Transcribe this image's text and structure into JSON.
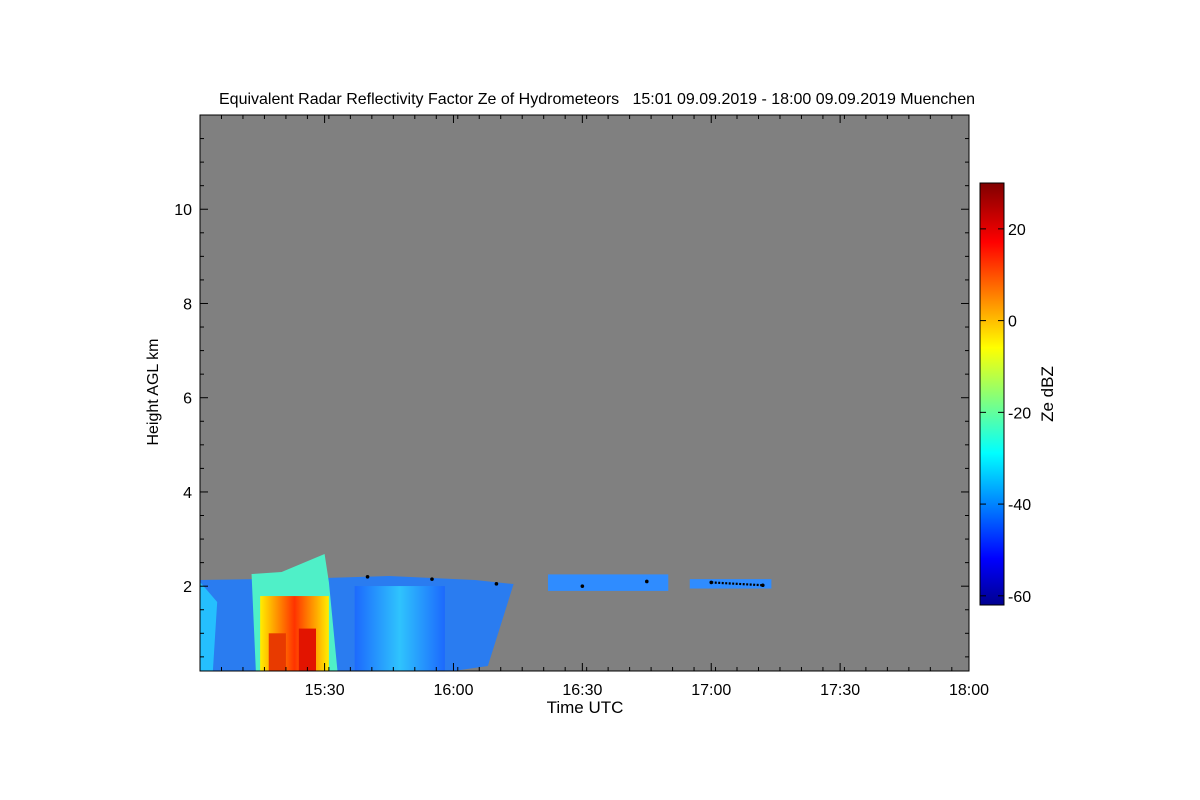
{
  "chart_data": {
    "type": "heatmap",
    "title": "Equivalent Radar Reflectivity Factor Ze of Hydrometeors   15:01 09.09.2019 - 18:00 09.09.2019 Muenchen",
    "xlabel": "Time UTC",
    "ylabel": "Height AGL km",
    "x_ticks": [
      "15:30",
      "16:00",
      "16:30",
      "17:00",
      "17:30",
      "18:00"
    ],
    "y_ticks": [
      "2",
      "4",
      "6",
      "8",
      "10"
    ],
    "xlim": [
      "15:01",
      "18:00"
    ],
    "ylim": [
      0.2,
      12.0
    ],
    "grid": false,
    "background_color": "#808080",
    "colorbar": {
      "label": "Ze dBZ",
      "range": [
        -62,
        30
      ],
      "ticks": [
        "20",
        "0",
        "-20",
        "-40",
        "-60"
      ],
      "colormap": "jet"
    },
    "echo_regions": [
      {
        "start": "15:01",
        "end": "16:14",
        "top_km": 2.3,
        "peak_dbz": 22,
        "peak_time": "15:25",
        "description_level": "precipitation to ground"
      },
      {
        "start": "16:22",
        "end": "16:50",
        "top_km": 2.25,
        "base_km": 1.9,
        "peak_dbz": -38
      },
      {
        "start": "16:55",
        "end": "17:14",
        "top_km": 2.15,
        "base_km": 1.95,
        "peak_dbz": -42
      }
    ],
    "cloud_base_height_km": [
      {
        "time": "15:40",
        "value": 2.2
      },
      {
        "time": "15:55",
        "value": 2.15
      },
      {
        "time": "16:10",
        "value": 2.05
      },
      {
        "time": "16:30",
        "value": 2.0
      },
      {
        "time": "16:45",
        "value": 2.1
      },
      {
        "time": "17:00",
        "value": 2.08
      },
      {
        "time": "17:12",
        "value": 2.02
      }
    ]
  }
}
